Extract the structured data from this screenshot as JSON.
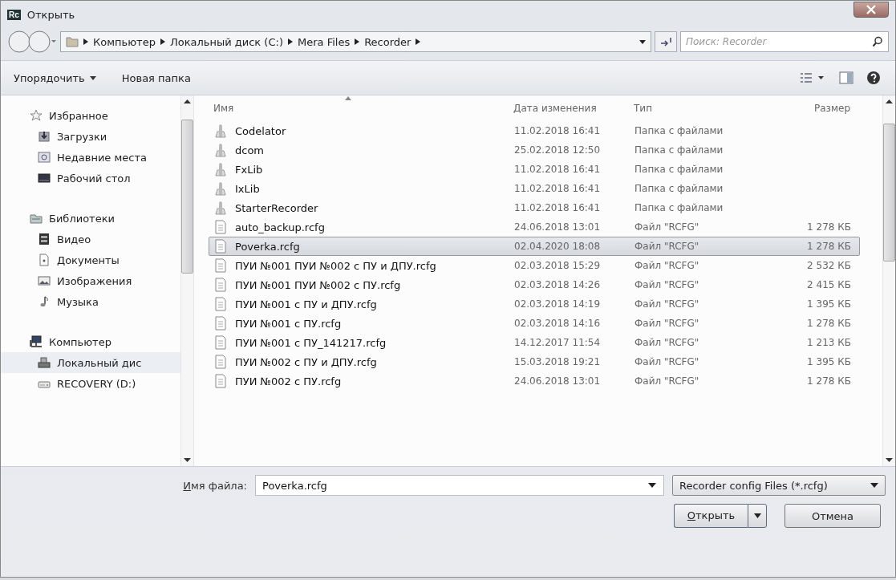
{
  "window": {
    "app_icon": "Rc",
    "title": "Открыть"
  },
  "address_bar": {
    "path": [
      "Компьютер",
      "Локальный диск (C:)",
      "Mera Files",
      "Recorder"
    ]
  },
  "search": {
    "placeholder": "Поиск: Recorder"
  },
  "toolbar": {
    "buttons": [
      {
        "label": "Упорядочить",
        "dropdown": true
      },
      {
        "label": "Новая папка",
        "dropdown": false
      }
    ]
  },
  "sidebar": {
    "groups": [
      {
        "label": "Избранное",
        "selected": false,
        "children": [
          {
            "label": "Загрузки",
            "selected": false
          },
          {
            "label": "Недавние места",
            "selected": false
          },
          {
            "label": "Рабочий стол",
            "selected": false
          }
        ]
      },
      {
        "label": "Библиотеки",
        "selected": false,
        "children": [
          {
            "label": "Видео",
            "selected": false
          },
          {
            "label": "Документы",
            "selected": false
          },
          {
            "label": "Изображения",
            "selected": false
          },
          {
            "label": "Музыка",
            "selected": false
          }
        ]
      },
      {
        "label": "Компьютер",
        "selected": false,
        "children": [
          {
            "label": "Локальный дис",
            "selected": true
          },
          {
            "label": "RECOVERY (D:)",
            "selected": false
          }
        ]
      }
    ]
  },
  "table": {
    "columns": [
      "Имя",
      "Дата изменения",
      "Тип",
      "Размер"
    ],
    "rows": [
      {
        "kind": "folder",
        "name": "Codelator",
        "date": "11.02.2018 16:41",
        "type": "Папка с файлами",
        "selected": false
      },
      {
        "kind": "folder",
        "name": "dcom",
        "date": "25.02.2018 12:50",
        "type": "Папка с файлами",
        "selected": false
      },
      {
        "kind": "folder",
        "name": "FxLib",
        "date": "11.02.2018 16:41",
        "type": "Папка с файлами",
        "selected": false
      },
      {
        "kind": "folder",
        "name": "IxLib",
        "date": "11.02.2018 16:41",
        "type": "Папка с файлами",
        "selected": false
      },
      {
        "kind": "folder",
        "name": "StarterRecorder",
        "date": "11.02.2018 16:41",
        "type": "Папка с файлами",
        "selected": false
      },
      {
        "kind": "file",
        "name": "auto_backup.rcfg",
        "date": "24.06.2018 13:01",
        "type": "Файл \"RCFG\"",
        "size": "1 278 КБ",
        "selected": false
      },
      {
        "kind": "file",
        "name": "Poverka.rcfg",
        "date": "02.04.2020 18:08",
        "type": "Файл \"RCFG\"",
        "size": "1 278 КБ",
        "selected": true
      },
      {
        "kind": "file",
        "name": "ПУИ №001 ПУИ №002 с ПУ и ДПУ.rcfg",
        "date": "02.03.2018 15:29",
        "type": "Файл \"RCFG\"",
        "size": "2 532 КБ",
        "selected": false
      },
      {
        "kind": "file",
        "name": "ПУИ №001 ПУИ №002 с ПУ.rcfg",
        "date": "02.03.2018 14:26",
        "type": "Файл \"RCFG\"",
        "size": "2 415 КБ",
        "selected": false
      },
      {
        "kind": "file",
        "name": "ПУИ №001 с ПУ и ДПУ.rcfg",
        "date": "02.03.2018 14:19",
        "type": "Файл \"RCFG\"",
        "size": "1 395 КБ",
        "selected": false
      },
      {
        "kind": "file",
        "name": "ПУИ №001 с ПУ.rcfg",
        "date": "02.03.2018 14:16",
        "type": "Файл \"RCFG\"",
        "size": "1 278 КБ",
        "selected": false
      },
      {
        "kind": "file",
        "name": "ПУИ №001 с ПУ_141217.rcfg",
        "date": "14.12.2017 11:54",
        "type": "Файл \"RCFG\"",
        "size": "1 213 КБ",
        "selected": false
      },
      {
        "kind": "file",
        "name": "ПУИ №002 с ПУ и ДПУ.rcfg",
        "date": "15.03.2018 19:21",
        "type": "Файл \"RCFG\"",
        "size": "1 395 КБ",
        "selected": false
      },
      {
        "kind": "file",
        "name": "ПУИ №002 с ПУ.rcfg",
        "date": "24.06.2018 13:01",
        "type": "Файл \"RCFG\"",
        "size": "1 278 КБ",
        "selected": false
      }
    ]
  },
  "file_name": {
    "label": "Имя файла:",
    "value": "Poverka.rcfg"
  },
  "file_type": {
    "value": "Recorder config Files (*.rcfg)"
  },
  "buttons": [
    {
      "label": "Открыть",
      "kind": "split"
    },
    {
      "label": "Отмена",
      "kind": "plain"
    }
  ]
}
